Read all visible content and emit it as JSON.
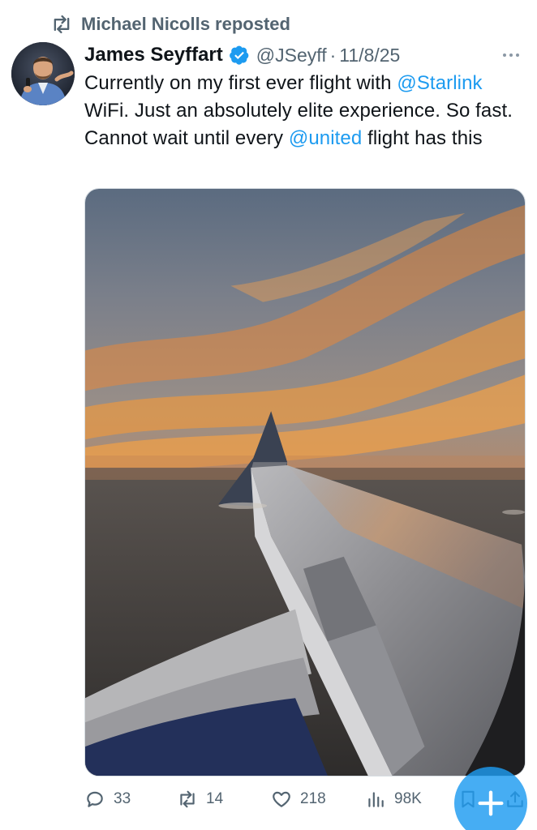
{
  "repost": {
    "text": "Michael Nicolls reposted",
    "icon": "repost-icon"
  },
  "author": {
    "name": "James Seyffart",
    "handle": "@JSeyff",
    "separator": "·",
    "date": "11/8/25",
    "verified_icon": "verified-badge-icon",
    "verified_color": "#1d9bf0"
  },
  "tweet": {
    "parts": [
      {
        "text": "Currently on my first ever flight with ",
        "mention": false
      },
      {
        "text": "@Starlink",
        "mention": true
      },
      {
        "text": " WiFi. Just an absolutely elite experience. So fast. Cannot wait until every ",
        "mention": false
      },
      {
        "text": "@united",
        "mention": true
      },
      {
        "text": " flight has this",
        "mention": false
      }
    ]
  },
  "media": {
    "kind": "photo",
    "icon": "airplane-wing-sunset-photo"
  },
  "actions": {
    "replies": "33",
    "reposts": "14",
    "likes": "218",
    "views": "98K"
  },
  "colors": {
    "mention": "#1d9bf0",
    "secondary_text": "#536471",
    "primary_text": "#0f1419",
    "fab": "#1d9bf0"
  }
}
